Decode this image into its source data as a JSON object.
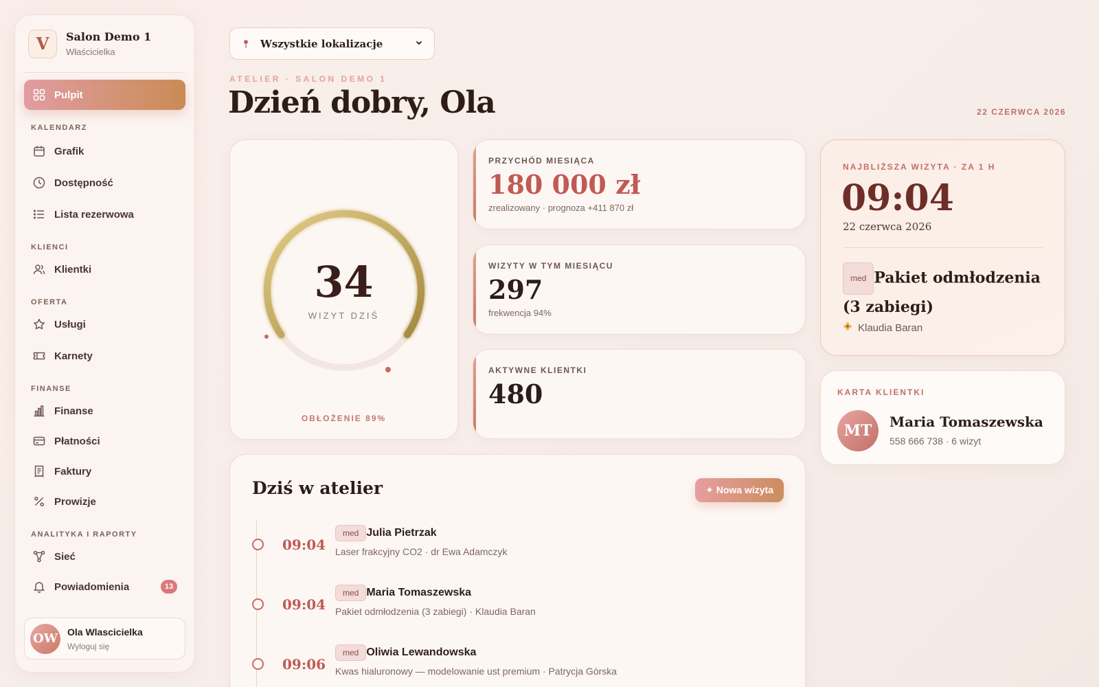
{
  "sidebar": {
    "brand_initial": "V",
    "brand_name": "Salon Demo 1",
    "brand_role": "Właścicielka",
    "active": {
      "label": "Pulpit",
      "icon": "grid-icon"
    },
    "sections": {
      "kalendarz": "KALENDARZ",
      "klienci": "KLIENCI",
      "oferta": "OFERTA",
      "finanse": "FINANSE",
      "analityka": "ANALITYKA I RAPORTY"
    },
    "items": {
      "grafik": "Grafik",
      "dostepnosc": "Dostępność",
      "lista": "Lista rezerwowa",
      "klientki": "Klientki",
      "uslugi": "Usługi",
      "karnety": "Karnety",
      "finanse": "Finanse",
      "platnosci": "Płatności",
      "faktury": "Faktury",
      "prowizje": "Prowizje",
      "siec": "Sieć",
      "powiadomienia": "Powiadomienia"
    },
    "notifications_count": "13",
    "user": {
      "initials": "OW",
      "name": "Ola Wlascicielka",
      "logout": "Wyloguj się"
    }
  },
  "header": {
    "location": "Wszystkie lokalizacje",
    "eyebrow": "ATELIER · SALON DEMO 1",
    "greeting_prefix": "Dzień dobry, ",
    "greeting_name": "Ola",
    "date": "22 CZERWCA 2026"
  },
  "ring": {
    "value": "34",
    "label": "WIZYT DZIŚ",
    "footer": "OBŁOŻENIE 89%",
    "occupancy": 0.89
  },
  "stats": {
    "revenue": {
      "label": "PRZYCHÓD MIESIĄCA",
      "value": "180 000 zł",
      "sub": "zrealizowany · prognoza +411 870 zł"
    },
    "visits": {
      "label": "WIZYTY W TYM MIESIĄCU",
      "value": "297",
      "sub": "frekwencja 94%"
    },
    "clients": {
      "label": "AKTYWNE KLIENTKI",
      "value": "480"
    }
  },
  "next": {
    "eyebrow": "NAJBLIŻSZA WIZYTA · ZA 1 H",
    "time": "09:04",
    "date": "22 czerwca 2026",
    "tag": "med",
    "title": "Pakiet odmłodzenia (3 zabiegi)",
    "specialist": "Klaudia Baran"
  },
  "client": {
    "eyebrow": "KARTA KLIENTKI",
    "initials": "MT",
    "name": "Maria Tomaszewska",
    "meta": "558 666 738 · 6 wizyt"
  },
  "today": {
    "title": "Dziś w atelier",
    "new_button": "✦ Nowa wizyta",
    "appointments": [
      {
        "time": "09:04",
        "tag": "med",
        "name": "Julia Pietrzak",
        "desc": "Laser frakcyjny CO2 · dr Ewa Adamczyk"
      },
      {
        "time": "09:04",
        "tag": "med",
        "name": "Maria Tomaszewska",
        "desc": "Pakiet odmłodzenia (3 zabiegi) · Klaudia Baran"
      },
      {
        "time": "09:06",
        "tag": "med",
        "name": "Oliwia Lewandowska",
        "desc": "Kwas hialuronowy — modelowanie ust premium · Patrycja Górska"
      }
    ]
  },
  "colors": {
    "accent": "#c05a55",
    "ring_gold": "#b89a4c",
    "active_gradient_start": "#e19ca1",
    "active_gradient_end": "#c98c55"
  }
}
